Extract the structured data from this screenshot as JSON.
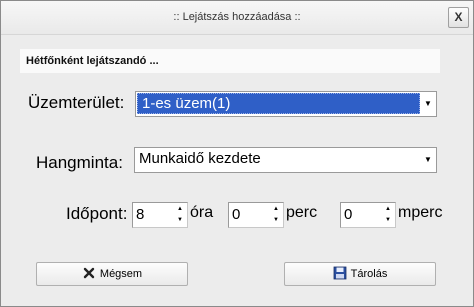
{
  "window": {
    "title": ":: Lejátszás hozzáadása ::",
    "close_label": "X"
  },
  "section": {
    "header": "Hétfőnként lejátszandó ..."
  },
  "fields": {
    "plant_label": "Üzemterület:",
    "plant_value": "1-es üzem(1)",
    "sound_label": "Hangminta:",
    "sound_value": "Munkaidő kezdete",
    "time_label": "Időpont:",
    "hour_value": "8",
    "hour_unit": "óra",
    "minute_value": "0",
    "minute_unit": "perc",
    "second_value": "0",
    "second_unit": "mperc"
  },
  "buttons": {
    "cancel_label": "Mégsem",
    "cancel_icon": "x-icon",
    "save_label": "Tárolás",
    "save_icon": "floppy-disk-icon"
  }
}
